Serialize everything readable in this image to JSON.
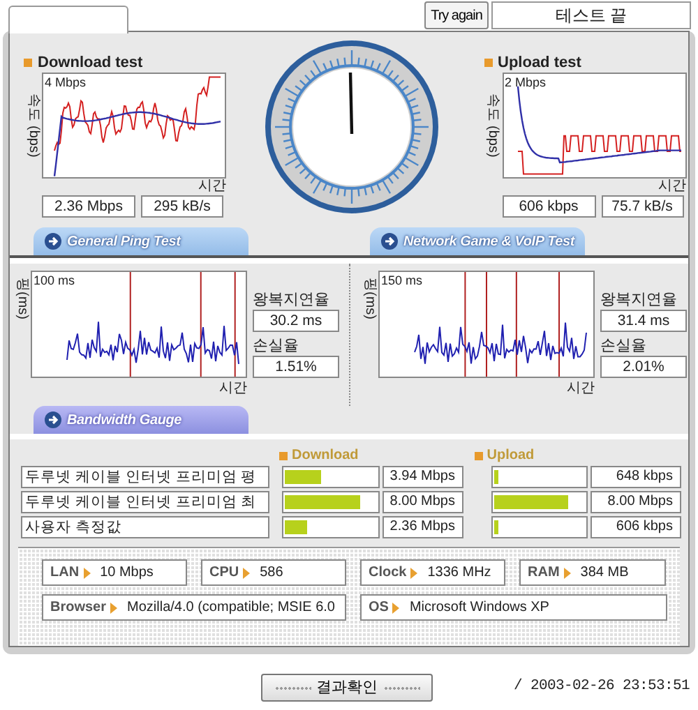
{
  "top_bar": {
    "try_again": "Try again",
    "status": "테스트 끝"
  },
  "speed_tests": [
    {
      "title": "Download test",
      "scale": "4 Mbps",
      "y_label": "속도 (bps)",
      "x_label": "시간",
      "readings": [
        "2.36 Mbps",
        "295 kB/s"
      ],
      "kind": "download"
    },
    {
      "title": "Upload test",
      "scale": "2 Mbps",
      "y_label": "속도 (bps)",
      "x_label": "시간",
      "readings": [
        "606 kbps",
        "75.7 kB/s"
      ],
      "kind": "upload"
    }
  ],
  "ping_tabs": [
    {
      "label": "General Ping Test"
    },
    {
      "label": "Network Game & VoIP Test"
    }
  ],
  "ping_tests": [
    {
      "scale": "100 ms",
      "y_label": "핑(ms)",
      "x_label": "시간",
      "latency_label": "왕복지연율",
      "latency": "30.2 ms",
      "loss_label": "손실율",
      "loss": "1.51%"
    },
    {
      "scale": "150 ms",
      "y_label": "핑(ms)",
      "x_label": "시간",
      "latency_label": "왕복지연율",
      "latency": "31.4 ms",
      "loss_label": "손실율",
      "loss": "2.01%"
    }
  ],
  "bandwidth": {
    "title": "Bandwidth Gauge",
    "columns": [
      "Download",
      "Upload"
    ],
    "rows": [
      {
        "name": "두루넷 케이블 인터넷 프리미엄 평",
        "download": {
          "level": 0.4,
          "value": "3.94 Mbps"
        },
        "upload": {
          "level": 0.05,
          "value": "648 kbps"
        }
      },
      {
        "name": "두루넷 케이블 인터넷 프리미엄 최",
        "download": {
          "level": 0.82,
          "value": "8.00 Mbps"
        },
        "upload": {
          "level": 0.82,
          "value": "8.00 Mbps"
        }
      },
      {
        "name": "사용자 측정값",
        "download": {
          "level": 0.24,
          "value": "2.36 Mbps"
        },
        "upload": {
          "level": 0.05,
          "value": "606 kbps"
        }
      }
    ]
  },
  "system_info": [
    [
      {
        "label": "LAN",
        "value": "10 Mbps"
      },
      {
        "label": "CPU",
        "value": "586"
      },
      {
        "label": "Clock",
        "value": "1336 MHz"
      },
      {
        "label": "RAM",
        "value": "384 MB"
      }
    ],
    [
      {
        "label": "Browser",
        "value": "Mozilla/4.0 (compatible; MSIE 6.0"
      },
      {
        "label": "OS",
        "value": "Microsoft Windows XP"
      }
    ]
  ],
  "confirm_button": "결과확인",
  "timestamp": "/ 2003-02-26 23:53:51"
}
